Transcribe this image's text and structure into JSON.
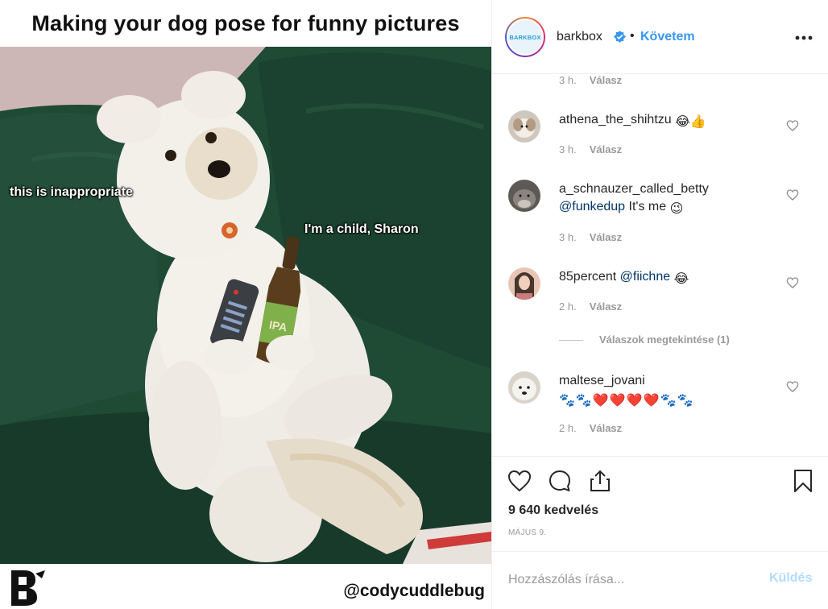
{
  "meme": {
    "title": "Making your dog pose for funny pictures",
    "caption_left": "this is inappropriate",
    "caption_right": "I'm a child, Sharon",
    "credit": "@codycuddlebug",
    "bottle_label": "IPA"
  },
  "post": {
    "brand_avatar_text": "BARKBOX",
    "username": "barkbox",
    "separator": "•",
    "follow_label": "Követem",
    "more_icon": "more-horizontal-icon",
    "verified_icon": "verified-badge-icon"
  },
  "comments": {
    "top_meta": {
      "time": "3 h.",
      "reply": "Válasz"
    },
    "items": [
      {
        "user": "athena_the_shihtzu",
        "mention": "",
        "text": "",
        "emojis": "😂👍",
        "time": "3 h.",
        "reply": "Válasz"
      },
      {
        "user": "a_schnauzer_called_betty",
        "mention": "@funkedup",
        "text": "It's me",
        "emojis": "😉",
        "time": "3 h.",
        "reply": "Válasz"
      },
      {
        "user": "85percent",
        "mention": "@fiichne",
        "text": "",
        "emojis": "😂",
        "time": "2 h.",
        "reply": "Válasz"
      },
      {
        "user": "maltese_jovani",
        "mention": "",
        "text": "",
        "emojis": "🐾🐾❤️❤️❤️❤️🐾🐾",
        "time": "2 h.",
        "reply": "Válasz"
      }
    ],
    "view_replies": "Válaszok megtekintése (1)"
  },
  "actions": {
    "likes": "9 640 kedvelés",
    "date": "MÁJUS 9."
  },
  "comment_box": {
    "placeholder": "Hozzászólás írása...",
    "send_label": "Küldés"
  },
  "colors": {
    "link": "#3897f0",
    "mention": "#003569",
    "muted": "#999999",
    "send_disabled": "#b3dbff",
    "heart": "#ed4956"
  }
}
